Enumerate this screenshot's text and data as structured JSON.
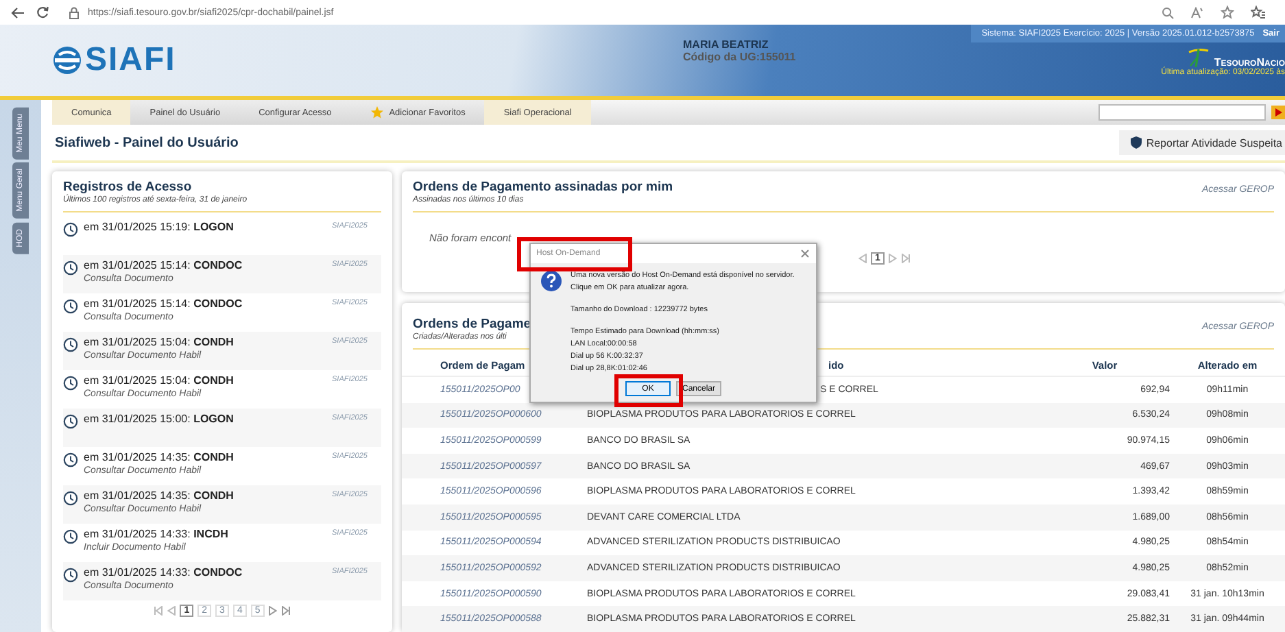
{
  "browser": {
    "url": "https://siafi.tesouro.gov.br/siafi2025/cpr-dochabil/painel.jsf"
  },
  "header": {
    "logo": "SIAFI",
    "user": "MARIA BEATRIZ",
    "ug": "Código da UG:**155011**",
    "system_info": "Sistema: SIAFI2025 Exercício: 2025 | Versão 2025.01.012-b2573875",
    "logout": "Sair",
    "brand": "TesouroNacio",
    "last_update": "Última atualização: 03/02/2025 às"
  },
  "nav": [
    {
      "label": "Comunica",
      "kind": "accent"
    },
    {
      "label": "Painel do Usuário",
      "kind": "plain"
    },
    {
      "label": "Configurar Acesso",
      "kind": "plain"
    },
    {
      "label": "Adicionar Favoritos",
      "kind": "favorite"
    },
    {
      "label": "Siafi Operacional",
      "kind": "accent"
    }
  ],
  "side_tabs": [
    "Meu Menu",
    "Menu Geral",
    "HOD"
  ],
  "page": {
    "title": "Siafiweb - Painel do Usuário",
    "report_button": "Reportar Atividade Suspeita"
  },
  "access_log": {
    "title": "Registros de Acesso",
    "subtitle": "Últimos 100 registros até sexta-feira, 31 de janeiro",
    "entries": [
      {
        "text": "em 31/01/2025 15:19: **LOGON**",
        "system": "SIAFI2025"
      },
      {
        "text": "em 31/01/2025 15:14: **CONDOC**",
        "system": "SIAFI2025",
        "description": "Consulta Documento"
      },
      {
        "text": "em 31/01/2025 15:14: **CONDOC**",
        "system": "SIAFI2025",
        "description": "Consulta Documento"
      },
      {
        "text": "em 31/01/2025 15:04: **CONDH**",
        "system": "SIAFI2025",
        "description": "Consultar Documento Habil"
      },
      {
        "text": "em 31/01/2025 15:04: **CONDH**",
        "system": "SIAFI2025",
        "description": "Consultar Documento Habil"
      },
      {
        "text": "em 31/01/2025 15:00: **LOGON**",
        "system": "SIAFI2025"
      },
      {
        "text": "em 31/01/2025 14:35: **CONDH**",
        "system": "SIAFI2025",
        "description": "Consultar Documento Habil"
      },
      {
        "text": "em 31/01/2025 14:35: **CONDH**",
        "system": "SIAFI2025",
        "description": "Consultar Documento Habil"
      },
      {
        "text": "em 31/01/2025 14:33: **INCDH**",
        "system": "SIAFI2025",
        "description": "Incluir Documento Habil"
      },
      {
        "text": "em 31/01/2025 14:33: **CONDOC**",
        "system": "SIAFI2025",
        "description": "Consulta Documento"
      }
    ],
    "pages": [
      {
        "label": "1",
        "selected": true
      },
      {
        "label": "2",
        "selected": false
      },
      {
        "label": "3",
        "selected": false
      },
      {
        "label": "4",
        "selected": false
      },
      {
        "label": "5",
        "selected": false
      }
    ]
  },
  "signed_orders": {
    "title": "Ordens de Pagamento assinadas por mim",
    "subtitle": "Assinadas nos últimos 10 dias",
    "link": "Acessar GEROP",
    "empty_message": "Não foram encont",
    "pages": [
      {
        "label": "1",
        "selected": true
      }
    ]
  },
  "orders": {
    "title": "Ordens de Pagame",
    "subtitle": "Criadas/Alteradas nos últi",
    "link": "Acessar GEROP",
    "columns": [
      "Ordem de Pagam",
      "ido",
      "Valor",
      "Alterado em"
    ],
    "rows": [
      {
        "order": "155011/2025OP00",
        "payee": "S E CORREL",
        "value": "692,94",
        "changed": "09h11min"
      },
      {
        "order": "155011/2025OP000600",
        "payee": "BIOPLASMA PRODUTOS PARA LABORATORIOS E CORREL",
        "value": "6.530,24",
        "changed": "09h08min"
      },
      {
        "order": "155011/2025OP000599",
        "payee": "BANCO DO BRASIL SA",
        "value": "90.974,15",
        "changed": "09h06min"
      },
      {
        "order": "155011/2025OP000597",
        "payee": "BANCO DO BRASIL SA",
        "value": "469,67",
        "changed": "09h03min"
      },
      {
        "order": "155011/2025OP000596",
        "payee": "BIOPLASMA PRODUTOS PARA LABORATORIOS E CORREL",
        "value": "1.393,42",
        "changed": "08h59min"
      },
      {
        "order": "155011/2025OP000595",
        "payee": "DEVANT CARE COMERCIAL LTDA",
        "value": "1.689,00",
        "changed": "08h56min"
      },
      {
        "order": "155011/2025OP000594",
        "payee": "ADVANCED STERILIZATION PRODUCTS DISTRIBUICAO",
        "value": "4.980,25",
        "changed": "08h54min"
      },
      {
        "order": "155011/2025OP000592",
        "payee": "ADVANCED STERILIZATION PRODUCTS DISTRIBUICAO",
        "value": "4.980,25",
        "changed": "08h52min"
      },
      {
        "order": "155011/2025OP000590",
        "payee": "BIOPLASMA PRODUTOS PARA LABORATORIOS E CORREL",
        "value": "29.083,41",
        "changed": "31 jan. 10h13min"
      },
      {
        "order": "155011/2025OP000588",
        "payee": "BIOPLASMA PRODUTOS PARA LABORATORIOS E CORREL",
        "value": "25.882,31",
        "changed": "31 jan. 09h44min"
      }
    ]
  },
  "dialog": {
    "title": "Host On-Demand",
    "title_highlighted": true,
    "lines": [
      "Uma nova versão do Host On-Demand está disponível no servidor.",
      "Clique em OK para atualizar agora."
    ],
    "size": "Tamanho do Download : 12239772 bytes",
    "times": [
      "Tempo Estimado para Download (hh:mm:ss)",
      "LAN Local:00:00:58",
      "Dial up 56 K:00:32:37",
      "Dial up 28,8K:01:02:46"
    ],
    "buttons": [
      {
        "label": "OK",
        "focused": true,
        "highlighted": true
      },
      {
        "label": "Cancelar",
        "focused": false,
        "highlighted": false
      }
    ]
  }
}
